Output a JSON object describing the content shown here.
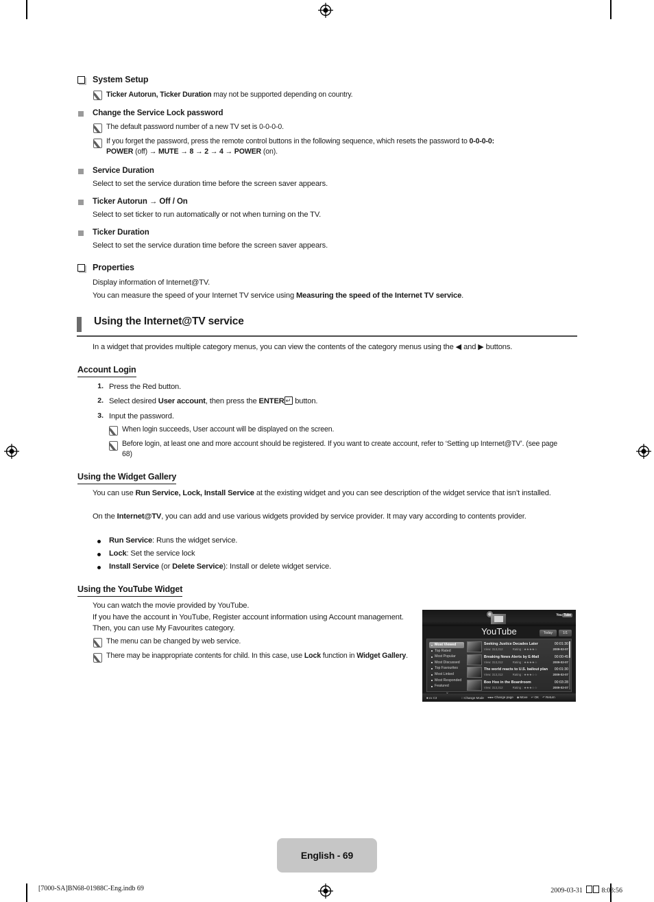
{
  "page": {
    "number_badge": "English - 69",
    "footer_left": "[7000-SA]BN68-01988C-Eng.indb   69",
    "footer_date": "2009-03-31",
    "footer_time": "8:03:56"
  },
  "sections": {
    "system_setup": {
      "heading": "System Setup",
      "note": "Ticker Autorun, Ticker Duration may not be supported depending on country.",
      "note_bold_1": "Ticker Autorun, Ticker Duration",
      "note_rest_1": " may not be supported depending on country."
    },
    "change_password": {
      "heading": "Change the Service Lock password",
      "note_1": "The default password number of a new TV set is 0-0-0-0.",
      "note_2_part1": "If you forget the password, press the remote control buttons in the following sequence, which resets the password to ",
      "note_2_bold": "0-0-0-0:",
      "note_2_line2_power": "POWER",
      "note_2_line2_off": " (off) → ",
      "note_2_line2_mute": "MUTE",
      "note_2_line2_seq": " → 8 → 2 → 4 → ",
      "note_2_line2_power2": "POWER",
      "note_2_line2_on": " (on)."
    },
    "service_duration": {
      "heading": "Service Duration",
      "body": "Select to set the service duration time before the screen saver appears."
    },
    "ticker_autorun": {
      "heading_main": "Ticker Autorun",
      "heading_arrow": " → ",
      "heading_opts": "Off / On",
      "body": "Select to set ticker to run automatically or not when turning on the TV."
    },
    "ticker_duration": {
      "heading": "Ticker Duration",
      "body": "Select to set the service duration time before the screen saver appears."
    },
    "properties": {
      "heading": "Properties",
      "body_1": "Display information of Internet@TV.",
      "body_2_pre": "You can measure the speed of your Internet TV service using ",
      "body_2_bold": "Measuring the speed of the Internet TV service",
      "body_2_post": "."
    }
  },
  "band": {
    "title": "Using the Internet@TV service",
    "intro": "In a widget that provides multiple category menus, you can view the contents of the category menus using the ◀ and ▶ buttons."
  },
  "account_login": {
    "heading": "Account Login",
    "steps": [
      {
        "num": "1.",
        "text": "Press the Red button."
      },
      {
        "num": "2.",
        "pre": "Select desired ",
        "bold": "User account",
        "mid": ", then press the ",
        "bold2": "ENTER",
        "post": " button."
      },
      {
        "num": "3.",
        "text": "Input the password."
      }
    ],
    "notes": [
      "When login succeeds, User account will be displayed on the screen.",
      "Before login, at least one and more account should be registered. If you want to create account, refer to ‘Setting up Internet@TV’. (see page 68)"
    ]
  },
  "widget_gallery": {
    "heading": "Using the Widget Gallery",
    "p1_pre": "You can use ",
    "p1_bold": "Run Service, Lock, Install Service",
    "p1_post": " at the existing widget and you can see description of the widget service that isn’t installed.",
    "p2_pre": "On the ",
    "p2_bold": "Internet@TV",
    "p2_post": ", you can add and use various widgets provided by service provider. It may vary according to contents provider.",
    "bullets": [
      {
        "bold": "Run Service",
        "rest": ": Runs the widget service."
      },
      {
        "bold": "Lock",
        "rest": ": Set the service lock"
      },
      {
        "bold": "Install Service",
        "mid": " (or ",
        "bold2": "Delete Service",
        "rest": "): Install or delete widget service."
      }
    ]
  },
  "youtube_widget": {
    "heading": "Using the YouTube Widget",
    "p1": "You can watch the movie provided by YouTube.",
    "p2": "If you have the account in YouTube, Register account information using Account management. Then, you can use My Favourites category.",
    "notes": [
      {
        "text": "The menu can be changed by web service."
      },
      {
        "pre": "There may be inappropriate contents for child. In this case, use ",
        "bold": "Lock",
        "mid": " function in ",
        "bold2": "Widget Gallery",
        "post": "."
      }
    ]
  },
  "tv_screenshot": {
    "title": "YouTube",
    "logo_text": "You",
    "logo_badge": "Tube",
    "tabs": [
      "Today",
      "1/1"
    ],
    "menu_items": [
      "Most Viewed",
      "Top Rated",
      "Most Popular",
      "Most Discussed",
      "Top Favourites",
      "Most Linked",
      "Most Responded",
      "Featured"
    ],
    "menu_selected_index": 0,
    "menu_more": "⌄",
    "videos": [
      {
        "title": "Seeking Justice Decades Later",
        "views": "View: 313,312",
        "rating": "Rating : ★★★★☆",
        "duration": "00:01:30",
        "date": "2009-02-07"
      },
      {
        "title": "Breaking News Alerts by E-Mail",
        "views": "View: 313,312",
        "rating": "Rating : ★★★★☆",
        "duration": "00:00:45",
        "date": "2009-02-07"
      },
      {
        "title": "The world reacts to U.S. bailout plan",
        "views": "View: 313,312",
        "rating": "Rating : ★★★☆☆",
        "duration": "00:01:30",
        "date": "2009-02-07"
      },
      {
        "title": "Boo Hoo in the Boardroom",
        "views": "View: 313,312",
        "rating": "Rating : ★★★☆☆",
        "duration": "00:03:28",
        "date": "2009-02-07"
      }
    ],
    "status_left": "■ ex C3",
    "status_change_mode": "Change Mode",
    "status_change_page": "Change page",
    "status_move": "Move",
    "status_ok": "OK",
    "status_return": "Return"
  }
}
